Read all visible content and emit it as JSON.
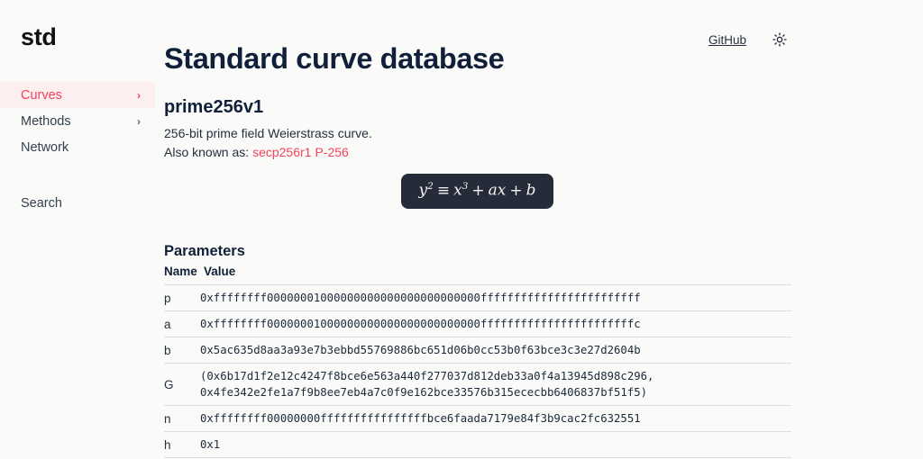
{
  "brand": {
    "logo": "std"
  },
  "topbar": {
    "github_label": "GitHub",
    "theme_toggle_icon": "sun-icon"
  },
  "sidebar": {
    "items": [
      {
        "label": "Curves",
        "chevron": "›",
        "active": true
      },
      {
        "label": "Methods",
        "chevron": "›",
        "active": false
      },
      {
        "label": "Network",
        "chevron": "",
        "active": false
      }
    ],
    "search_label": "Search"
  },
  "header": {
    "title": "Standard curve database"
  },
  "curve": {
    "name": "prime256v1",
    "description": "256-bit prime field Weierstrass curve.",
    "aka_label": "Also known as:",
    "aliases": [
      "secp256r1",
      "P-256"
    ]
  },
  "equation": {
    "lhs_base": "y",
    "lhs_exp": "2",
    "rel": "≡",
    "rhs_base": "x",
    "rhs_exp": "3",
    "plus1": "+",
    "term_ax": "ax",
    "plus2": "+",
    "term_b": "b"
  },
  "parameters": {
    "section_title": "Parameters",
    "columns": [
      "Name",
      "Value"
    ],
    "rows": [
      {
        "name": "p",
        "value": "0xffffffff00000001000000000000000000000000ffffffffffffffffffffffff"
      },
      {
        "name": "a",
        "value": "0xffffffff00000001000000000000000000000000fffffffffffffffffffffffc"
      },
      {
        "name": "b",
        "value": "0x5ac635d8aa3a93e7b3ebbd55769886bc651d06b0cc53b0f63bce3c3e27d2604b"
      },
      {
        "name": "G",
        "value": "(0x6b17d1f2e12c4247f8bce6e563a440f277037d812deb33a0f4a13945d898c296,\n0x4fe342e2fe1a7f9b8ee7eb4a7c0f9e162bce33576b315ececbb6406837bf51f5)"
      },
      {
        "name": "n",
        "value": "0xffffffff00000000ffffffffffffffffbce6faada7179e84f3b9cac2fc632551"
      },
      {
        "name": "h",
        "value": "0x1"
      }
    ]
  },
  "colors": {
    "accent": "#f1425c",
    "accent_bg": "#fdeef0",
    "heading": "#11203a",
    "page_bg": "#fafaf8",
    "eq_box_bg": "#262b3a",
    "table_border": "#dcdfe4"
  }
}
